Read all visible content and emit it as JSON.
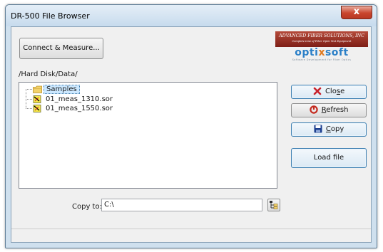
{
  "window": {
    "title": "DR-500 File Browser",
    "close_label": "x"
  },
  "header": {
    "connect_label": "Connect & Measure...",
    "logo": {
      "company": "ADVANCED FIBER SOLUTIONS, INC",
      "company_sub": "Complete Line of Fiber Optic Test Equipment",
      "brand_prefix": "opti",
      "brand_x": "x",
      "brand_suffix": "soft",
      "tagline": "Software Development for Fiber Optics"
    }
  },
  "path": "/Hard Disk/Data/",
  "tree": {
    "items": [
      {
        "label": "Samples",
        "icon": "folder-icon",
        "selected": true
      },
      {
        "label": "01_meas_1310.sor",
        "icon": "sor-file-icon",
        "selected": false
      },
      {
        "label": "01_meas_1550.sor",
        "icon": "sor-file-icon",
        "selected": false
      }
    ]
  },
  "buttons": {
    "close_prefix": "Clo",
    "close_mnemonic": "s",
    "close_suffix": "e",
    "refresh_mnemonic": "R",
    "refresh_suffix": "efresh",
    "copy_mnemonic": "C",
    "copy_suffix": "opy",
    "load_label": "Load file"
  },
  "copy_to": {
    "label": "Copy to:",
    "value": "C:\\"
  },
  "colors": {
    "close_icon": "#c8222c",
    "refresh_icon": "#c42a1e",
    "copy_icon": "#1d3f8f",
    "brand_blue": "#2a7fc7",
    "brand_orange": "#e07a1f"
  }
}
